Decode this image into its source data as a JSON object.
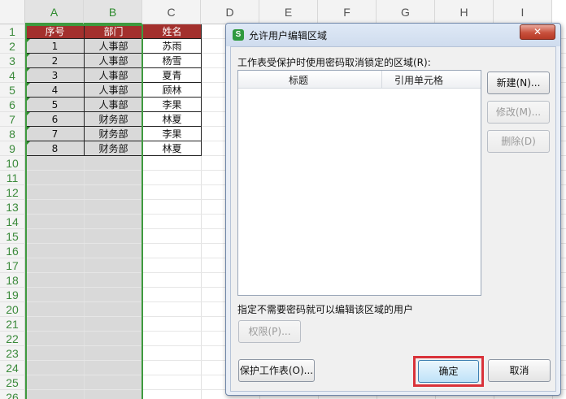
{
  "sheet": {
    "columns": [
      "A",
      "B",
      "C",
      "D",
      "E",
      "F",
      "G",
      "H",
      "I"
    ],
    "rows": [
      "1",
      "2",
      "3",
      "4",
      "5",
      "6",
      "7",
      "8",
      "9",
      "10",
      "11",
      "12",
      "13",
      "14",
      "15",
      "16",
      "17",
      "18",
      "19",
      "20",
      "21",
      "22",
      "23",
      "24",
      "25",
      "26"
    ],
    "table": {
      "headers": [
        "序号",
        "部门",
        "姓名"
      ],
      "rows": [
        [
          "1",
          "人事部",
          "苏雨"
        ],
        [
          "2",
          "人事部",
          "杨雪"
        ],
        [
          "3",
          "人事部",
          "夏青"
        ],
        [
          "4",
          "人事部",
          "顾林"
        ],
        [
          "5",
          "人事部",
          "李果"
        ],
        [
          "6",
          "财务部",
          "林夏"
        ],
        [
          "7",
          "财务部",
          "李果"
        ],
        [
          "8",
          "财务部",
          "林夏"
        ]
      ]
    },
    "colors": {
      "header_fill": "#a3302d",
      "selection_border": "#3f9a3f"
    }
  },
  "dialog": {
    "title": "允许用户编辑区域",
    "app_icon": "wps-s-icon",
    "close_icon": "close-icon",
    "close_glyph": "✕",
    "ranges_label": "工作表受保护时使用密码取消锁定的区域(R):",
    "list_headers": {
      "title": "标题",
      "cell_ref": "引用单元格"
    },
    "new_button": "新建(N)...",
    "modify_button": "修改(M)...",
    "delete_button": "删除(D)",
    "users_label": "指定不需要密码就可以编辑该区域的用户",
    "permissions_button": "权限(P)...",
    "protect_sheet_button": "保护工作表(O)...",
    "ok_button": "确定",
    "cancel_button": "取消",
    "colors": {
      "highlight": "#d9323a"
    }
  }
}
